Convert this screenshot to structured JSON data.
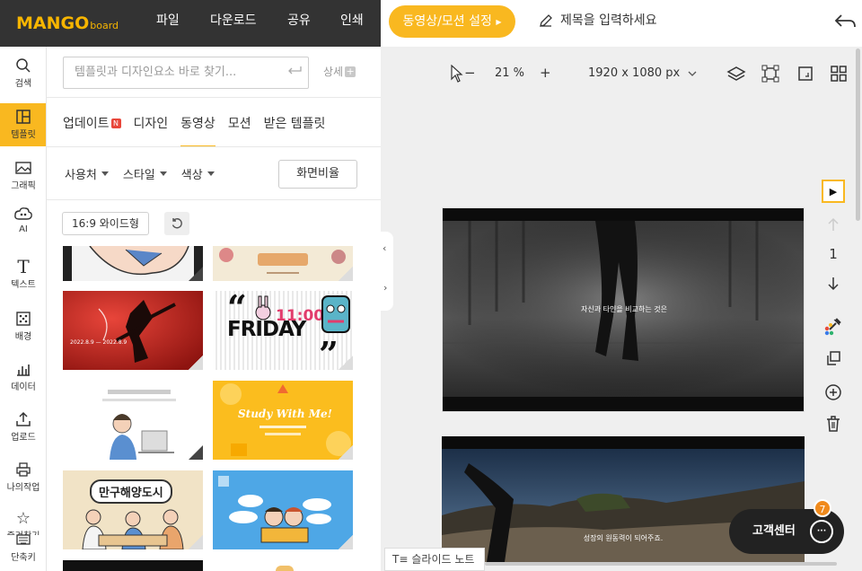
{
  "header": {
    "logo_main": "MANGO",
    "logo_sub": "board",
    "menus": [
      "파일",
      "다운로드",
      "공유",
      "인쇄"
    ],
    "motion_button": "동영상/모션 설정",
    "title_placeholder": "제목을 입력하세요"
  },
  "nav": {
    "items": [
      {
        "label": "검색",
        "icon": "search-icon"
      },
      {
        "label": "템플릿",
        "icon": "template-icon"
      },
      {
        "label": "그래픽",
        "icon": "image-icon"
      },
      {
        "label": "AI",
        "icon": "ai-icon"
      },
      {
        "label": "텍스트",
        "icon": "text-icon"
      },
      {
        "label": "배경",
        "icon": "background-icon"
      },
      {
        "label": "데이터",
        "icon": "chart-icon"
      },
      {
        "label": "업로드",
        "icon": "upload-icon"
      },
      {
        "label": "나의작업",
        "icon": "printer-icon"
      },
      {
        "label": "즐겨찾기",
        "icon": "star-icon"
      },
      {
        "label": "단축키",
        "icon": "keyboard-icon"
      }
    ]
  },
  "panel": {
    "search_placeholder": "템플릿과 디자인요소 바로 찾기...",
    "detail_label": "상세",
    "tabs": [
      {
        "label": "업데이트",
        "badge": "N"
      },
      {
        "label": "디자인"
      },
      {
        "label": "동영상"
      },
      {
        "label": "모션"
      },
      {
        "label": "받은 템플릿"
      }
    ],
    "active_tab": "동영상",
    "filters": [
      "사용처",
      "스타일",
      "색상"
    ],
    "ratio_label": "화면비율",
    "chip_label": "16:9 와이드형",
    "thumbs": {
      "friday_text": "FRIDAY",
      "time_text": "11:00",
      "dates": "2022.8.9 — 2022.8.9",
      "study_text": "Study With Me!",
      "manggu_title": "만구해양도시"
    }
  },
  "canvas": {
    "zoom_minus": "−",
    "zoom_value": "21 %",
    "zoom_plus": "+",
    "size_label": "1920 x 1080 px",
    "page_number": "1",
    "slide1_caption": "자신과 타인을 비교하는 것은",
    "slide2_caption": "성장의 원동력이 되어주죠.",
    "notes_label": "슬라이드 노트"
  },
  "help": {
    "label": "고객센터",
    "badge_count": "7",
    "bubble_text": "···"
  },
  "colors": {
    "accent": "#f9b820",
    "header_dark": "#333333",
    "badge_red": "#e8463a",
    "help_badge": "#f08a1c"
  }
}
